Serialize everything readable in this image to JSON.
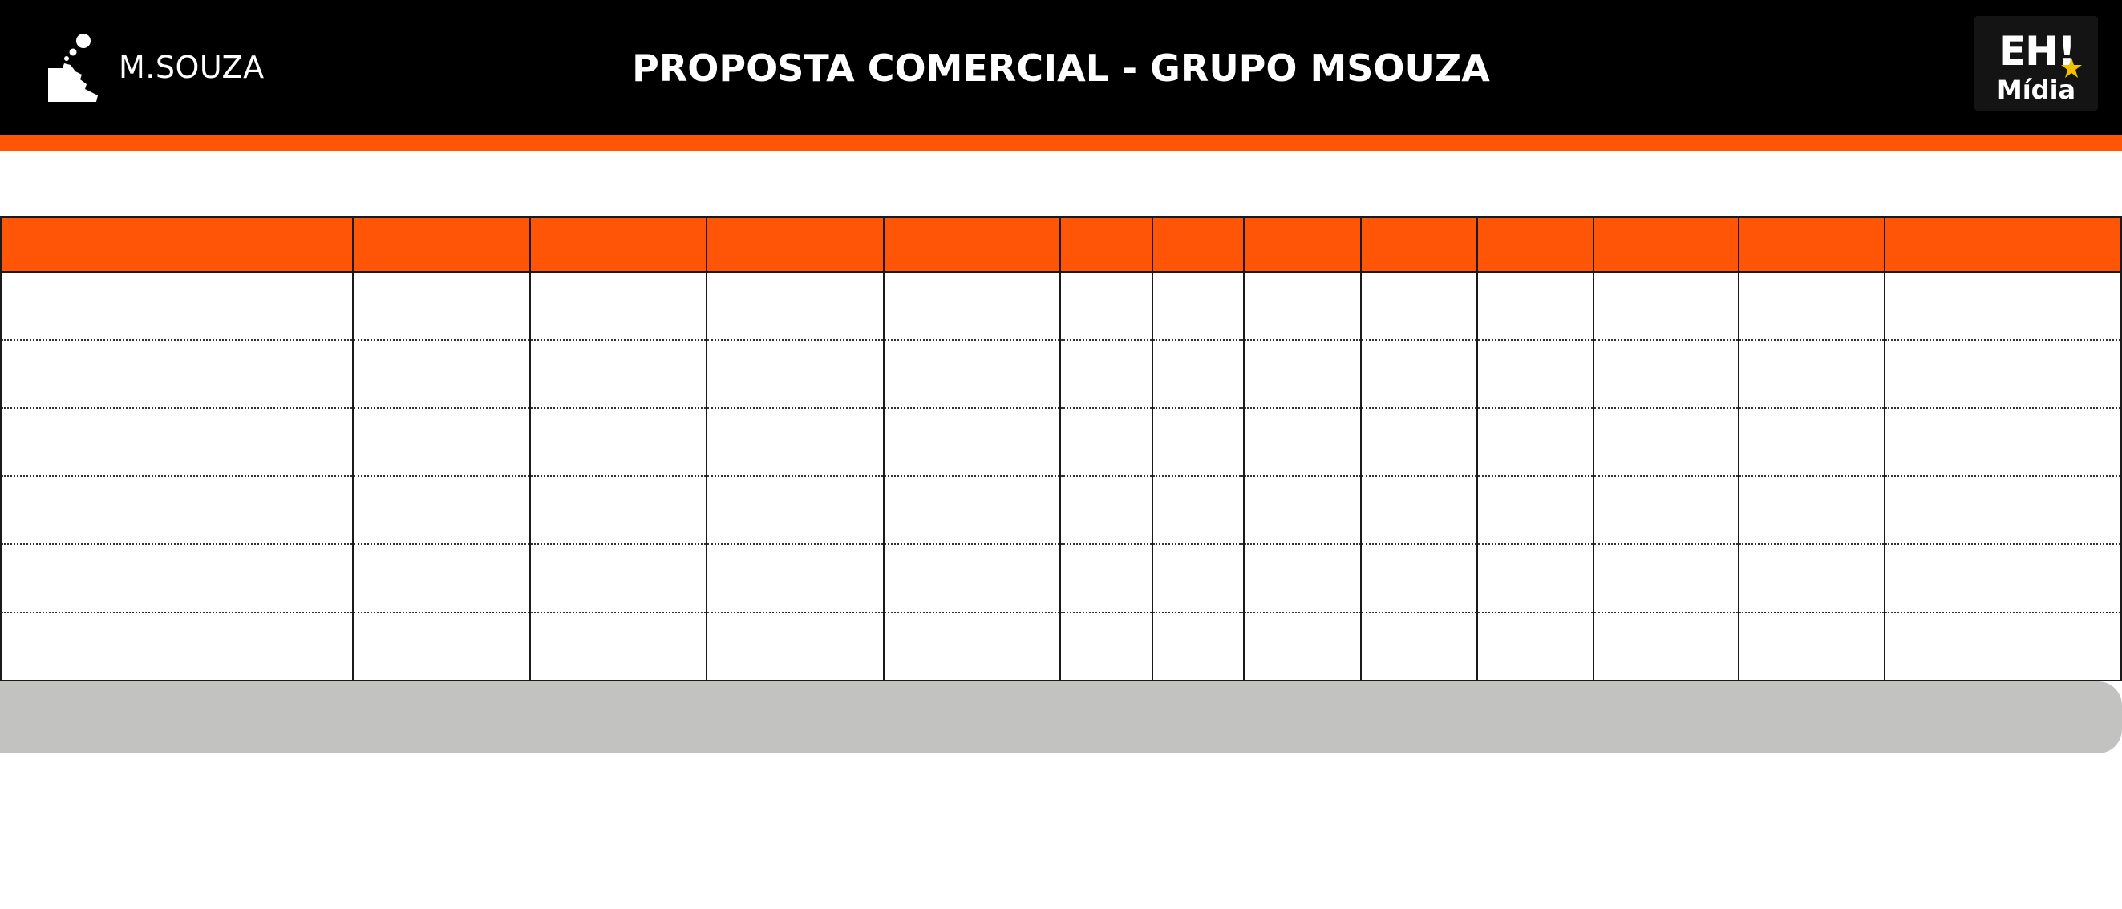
{
  "header": {
    "brand_name": "M.SOUZA",
    "title": "PROPOSTA COMERCIAL - GRUPO MSOUZA",
    "partner_logo": {
      "line1": "EH!",
      "line2": "Mídia"
    },
    "icons": [
      "msouza-logo-icon",
      "eh-midia-logo"
    ]
  },
  "colors": {
    "header_background": "#000000",
    "accent": "#ff5506",
    "footer_bar": "#c2c2c0"
  },
  "table": {
    "headers": [
      "",
      "",
      "",
      "",
      "",
      "",
      "",
      "",
      "",
      "",
      "",
      "",
      ""
    ],
    "rows": [
      [
        "",
        "",
        "",
        "",
        "",
        "",
        "",
        "",
        "",
        "",
        "",
        "",
        ""
      ],
      [
        "",
        "",
        "",
        "",
        "",
        "",
        "",
        "",
        "",
        "",
        "",
        "",
        ""
      ],
      [
        "",
        "",
        "",
        "",
        "",
        "",
        "",
        "",
        "",
        "",
        "",
        "",
        ""
      ],
      [
        "",
        "",
        "",
        "",
        "",
        "",
        "",
        "",
        "",
        "",
        "",
        "",
        ""
      ],
      [
        "",
        "",
        "",
        "",
        "",
        "",
        "",
        "",
        "",
        "",
        "",
        "",
        ""
      ],
      [
        "",
        "",
        "",
        "",
        "",
        "",
        "",
        "",
        "",
        "",
        "",
        "",
        ""
      ]
    ]
  },
  "footer": {
    "summary_text": ""
  }
}
